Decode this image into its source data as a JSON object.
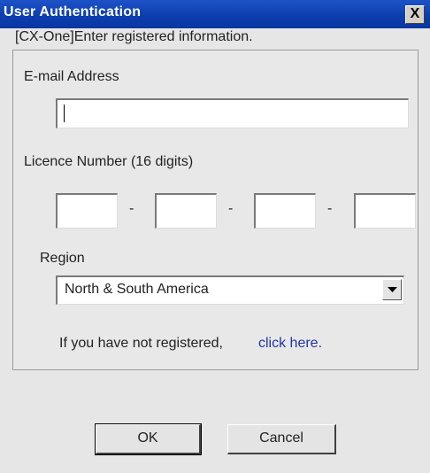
{
  "window": {
    "title": "User Authentication",
    "close_symbol": "X"
  },
  "instruction": "[CX-One]Enter registered information.",
  "form": {
    "email": {
      "label": "E-mail Address",
      "value": ""
    },
    "licence": {
      "label": "Licence Number (16 digits)",
      "segments": [
        "",
        "",
        "",
        ""
      ],
      "separator": "-"
    },
    "region": {
      "label": "Region",
      "selected": "North & South America"
    },
    "register_prompt": "If you have not registered,",
    "register_link": "click here."
  },
  "buttons": {
    "ok": "OK",
    "cancel": "Cancel"
  },
  "icons": {
    "close": "close-icon",
    "dropdown": "chevron-down-icon"
  },
  "colors": {
    "titlebar": "#0c3eb0",
    "link": "#2233aa",
    "dialog_bg": "#e6e6e6"
  }
}
